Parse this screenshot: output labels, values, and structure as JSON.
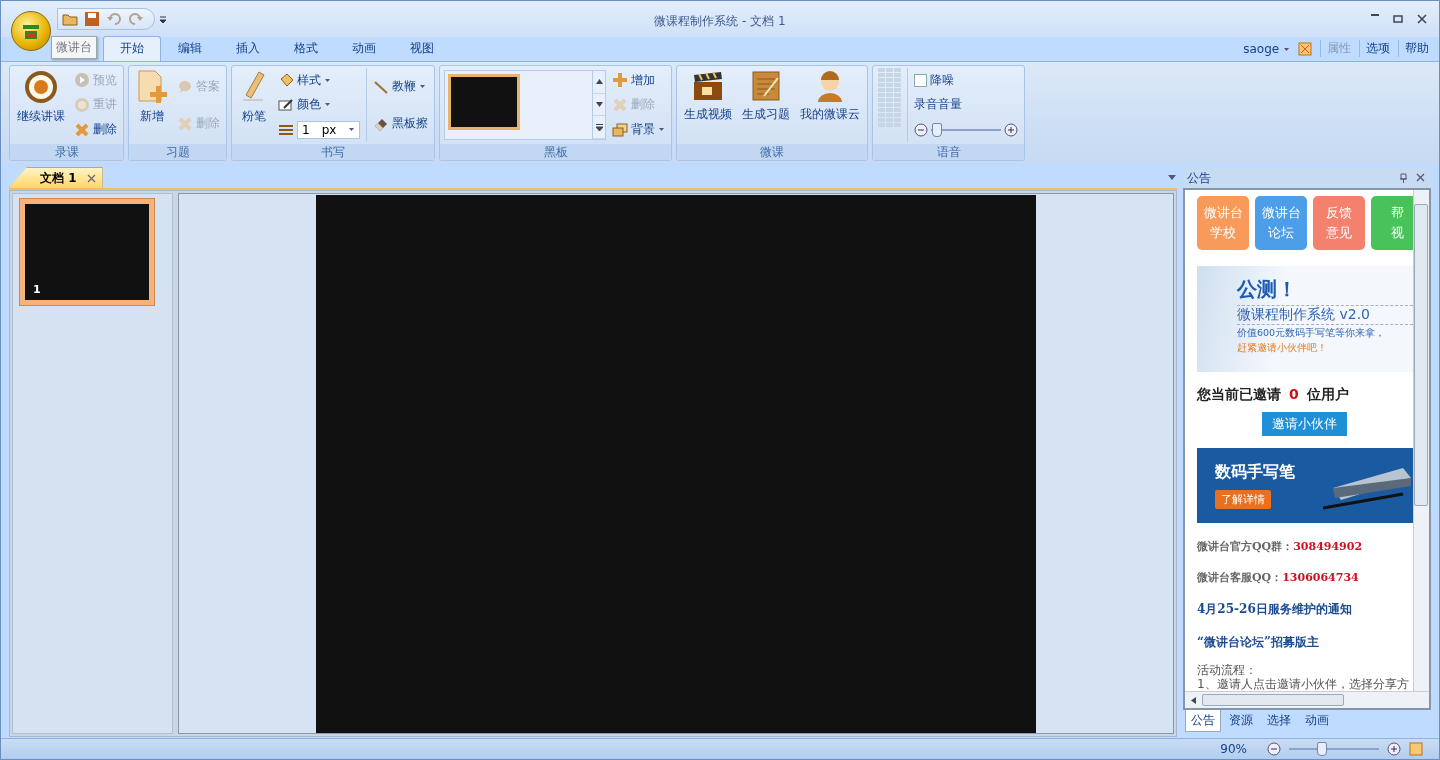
{
  "window": {
    "title": "微课程制作系统 - 文档 1"
  },
  "tooltip": "微讲台",
  "menu_tabs": [
    {
      "label": "开始",
      "selected": true
    },
    {
      "label": "编辑",
      "selected": false
    },
    {
      "label": "插入",
      "selected": false
    },
    {
      "label": "格式",
      "selected": false
    },
    {
      "label": "动画",
      "selected": false
    },
    {
      "label": "视图",
      "selected": false
    }
  ],
  "menu_right": {
    "user": "saoge",
    "links": [
      {
        "label": "属性",
        "disabled": true
      },
      {
        "label": "选项",
        "disabled": false
      },
      {
        "label": "帮助",
        "disabled": false
      }
    ]
  },
  "ribbon": [
    {
      "caption": "录课",
      "items": [
        {
          "kind": "large",
          "label": "继续讲课"
        },
        {
          "kind": "stack",
          "items": [
            {
              "label": "预览",
              "disabled": true,
              "dropdown": false
            },
            {
              "label": "重讲",
              "disabled": true,
              "dropdown": false
            },
            {
              "label": "删除",
              "disabled": false,
              "dropdown": false
            }
          ]
        }
      ]
    },
    {
      "caption": "习题",
      "items": [
        {
          "kind": "large",
          "label": "新增"
        },
        {
          "kind": "stack",
          "items": [
            {
              "label": "答案",
              "disabled": true,
              "dropdown": false
            },
            {
              "label": "删除",
              "disabled": true,
              "dropdown": false
            }
          ]
        }
      ]
    },
    {
      "caption": "书写",
      "items": [
        {
          "kind": "large",
          "label": "粉笔"
        },
        {
          "kind": "stack",
          "items": [
            {
              "label": "样式",
              "disabled": false,
              "dropdown": true
            },
            {
              "label": "颜色",
              "disabled": false,
              "dropdown": true
            },
            {
              "kind": "width",
              "value": "1",
              "unit": "px"
            }
          ]
        },
        {
          "kind": "stack",
          "items": [
            {
              "label": "教鞭",
              "disabled": false,
              "dropdown": true
            },
            {
              "label": "黑板擦",
              "disabled": false,
              "dropdown": false
            }
          ]
        }
      ]
    },
    {
      "caption": "黑板",
      "items": [
        {
          "kind": "gallery"
        },
        {
          "kind": "stack",
          "items": [
            {
              "label": "增加",
              "disabled": false,
              "dropdown": false
            },
            {
              "label": "删除",
              "disabled": true,
              "dropdown": false
            },
            {
              "label": "背景",
              "disabled": false,
              "dropdown": true
            }
          ]
        }
      ]
    },
    {
      "caption": "微课",
      "items": [
        {
          "kind": "large",
          "label": "生成视频"
        },
        {
          "kind": "large",
          "label": "生成习题"
        },
        {
          "kind": "large",
          "label": "我的微课云"
        }
      ]
    },
    {
      "caption": "语音",
      "items": [
        {
          "kind": "meter"
        },
        {
          "kind": "volume",
          "checkbox": {
            "label": "降噪",
            "checked": false
          },
          "label": "录音音量",
          "level": 0.06
        }
      ]
    }
  ],
  "document_tabs": [
    {
      "label": "文档 1",
      "selected": true
    }
  ],
  "slides": [
    {
      "number": "1",
      "selected": true
    }
  ],
  "side_panel": {
    "title": "公告",
    "tiles": [
      {
        "lines": [
          "微讲台",
          "学校"
        ],
        "color": "#f79a5a"
      },
      {
        "lines": [
          "微讲台",
          "论坛"
        ],
        "color": "#4c9ee8"
      },
      {
        "lines": [
          "反馈",
          "意见"
        ],
        "color": "#f4806e"
      },
      {
        "lines": [
          "帮",
          "视"
        ],
        "color": "#48c35a"
      }
    ],
    "promo": {
      "headline": "公测！",
      "product": "微课程制作系统 v2.0",
      "offer": "价值600元数码手写笔等你来拿，",
      "call": "赶紧邀请小伙伴吧！"
    },
    "invite": {
      "before": "您当前已邀请",
      "count": "0",
      "after": "位用户",
      "button": "邀请小伙伴"
    },
    "pen_banner": {
      "title": "数码手写笔",
      "button": "了解详情"
    },
    "contacts": [
      {
        "label": "微讲台官方QQ群：",
        "value": "308494902"
      },
      {
        "label": "微讲台客服QQ：",
        "value": "1306064734"
      }
    ],
    "notices": [
      "4月25-26日服务维护的通知",
      "“微讲台论坛”招募版主"
    ],
    "text_lines": [
      "活动流程：",
      "1、邀请人点击邀请小伙伴，选择分享方"
    ],
    "tabs": [
      {
        "label": "公告",
        "selected": true
      },
      {
        "label": "资源",
        "selected": false
      },
      {
        "label": "选择",
        "selected": false
      },
      {
        "label": "动画",
        "selected": false
      }
    ]
  },
  "status_bar": {
    "zoom": "90%",
    "zoom_level": {
      "level": 0.35
    }
  }
}
